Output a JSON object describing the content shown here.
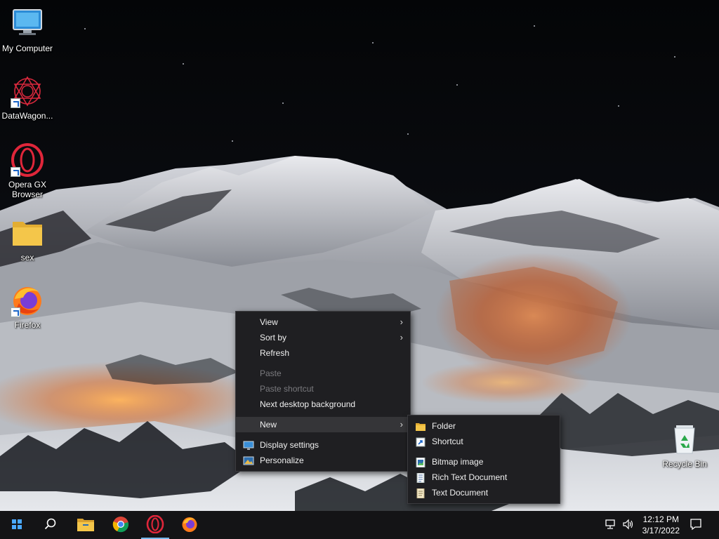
{
  "desktop_icons": [
    {
      "label": "My Computer",
      "icon": "monitor-icon",
      "shortcut": false
    },
    {
      "label": "DataWagon...",
      "icon": "datawagon-logo-icon",
      "shortcut": true
    },
    {
      "label": "Opera GX Browser",
      "icon": "opera-gx-icon",
      "shortcut": true
    },
    {
      "label": "sex",
      "icon": "folder-icon",
      "shortcut": false
    },
    {
      "label": "Firefox",
      "icon": "firefox-icon",
      "shortcut": true
    },
    {
      "label": "Recycle Bin",
      "icon": "recycle-bin-icon",
      "shortcut": false
    }
  ],
  "context_menu": {
    "items": [
      {
        "label": "View",
        "has_submenu": true,
        "disabled": false
      },
      {
        "label": "Sort by",
        "has_submenu": true,
        "disabled": false
      },
      {
        "label": "Refresh",
        "has_submenu": false,
        "disabled": false
      },
      {
        "label": "Paste",
        "has_submenu": false,
        "disabled": true
      },
      {
        "label": "Paste shortcut",
        "has_submenu": false,
        "disabled": true
      },
      {
        "label": "Next desktop background",
        "has_submenu": false,
        "disabled": false
      },
      {
        "label": "New",
        "has_submenu": true,
        "disabled": false,
        "active": true
      },
      {
        "label": "Display settings",
        "icon": "display-settings-icon",
        "disabled": false
      },
      {
        "label": "Personalize",
        "icon": "personalize-icon",
        "disabled": false
      }
    ],
    "arrow_glyph": "›"
  },
  "new_submenu": {
    "items": [
      {
        "label": "Folder",
        "icon": "folder-icon"
      },
      {
        "label": "Shortcut",
        "icon": "shortcut-icon"
      },
      {
        "label": "Bitmap image",
        "icon": "bitmap-image-icon"
      },
      {
        "label": "Rich Text Document",
        "icon": "rich-text-document-icon"
      },
      {
        "label": "Text Document",
        "icon": "text-document-icon"
      }
    ]
  },
  "taskbar": {
    "apps": [
      {
        "name": "start",
        "icon": "start-icon"
      },
      {
        "name": "search",
        "icon": "search-icon"
      },
      {
        "name": "file-explorer",
        "icon": "file-explorer-icon"
      },
      {
        "name": "chrome",
        "icon": "chrome-icon"
      },
      {
        "name": "opera-gx",
        "icon": "opera-gx-icon",
        "running": true
      },
      {
        "name": "firefox",
        "icon": "firefox-icon"
      }
    ],
    "tray": {
      "network_icon": "network-icon",
      "volume_icon": "volume-icon",
      "notifications_icon": "notifications-icon"
    },
    "clock": {
      "time": "12:12 PM",
      "date": "3/17/2022"
    }
  },
  "colors": {
    "menu_bg": "#1f1f22",
    "menu_text": "#f0f0f0",
    "menu_disabled": "#7a7a7e",
    "taskbar_bg": "#141416",
    "opera_red": "#e0263a",
    "folder_yellow": "#f4c64a"
  }
}
